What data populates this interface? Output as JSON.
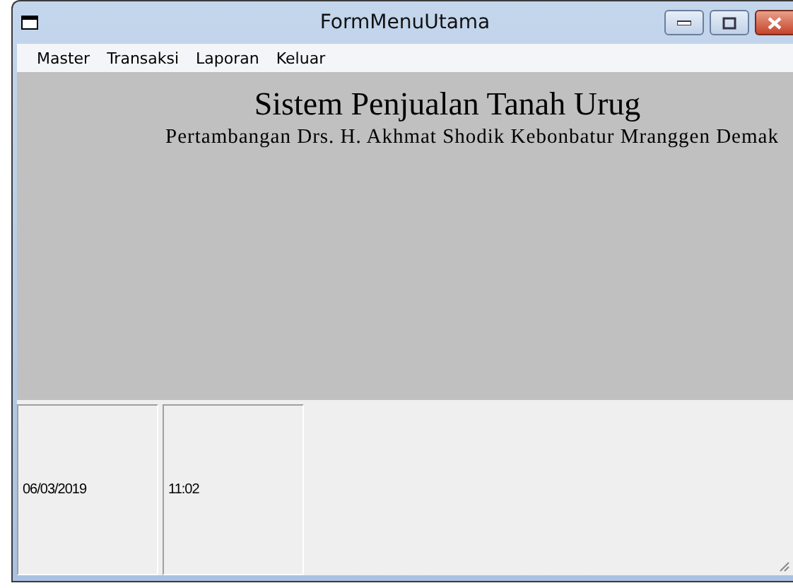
{
  "window": {
    "title": "FormMenuUtama"
  },
  "menu": [
    "Master",
    "Transaksi",
    "Laporan",
    "Keluar"
  ],
  "header": {
    "title": "Sistem Penjualan Tanah Urug",
    "subtitle": "Pertambangan Drs. H. Akhmat Shodik Kebonbatur Mranggen Demak"
  },
  "status_bar": [
    "06/03/2019",
    "11:02"
  ]
}
